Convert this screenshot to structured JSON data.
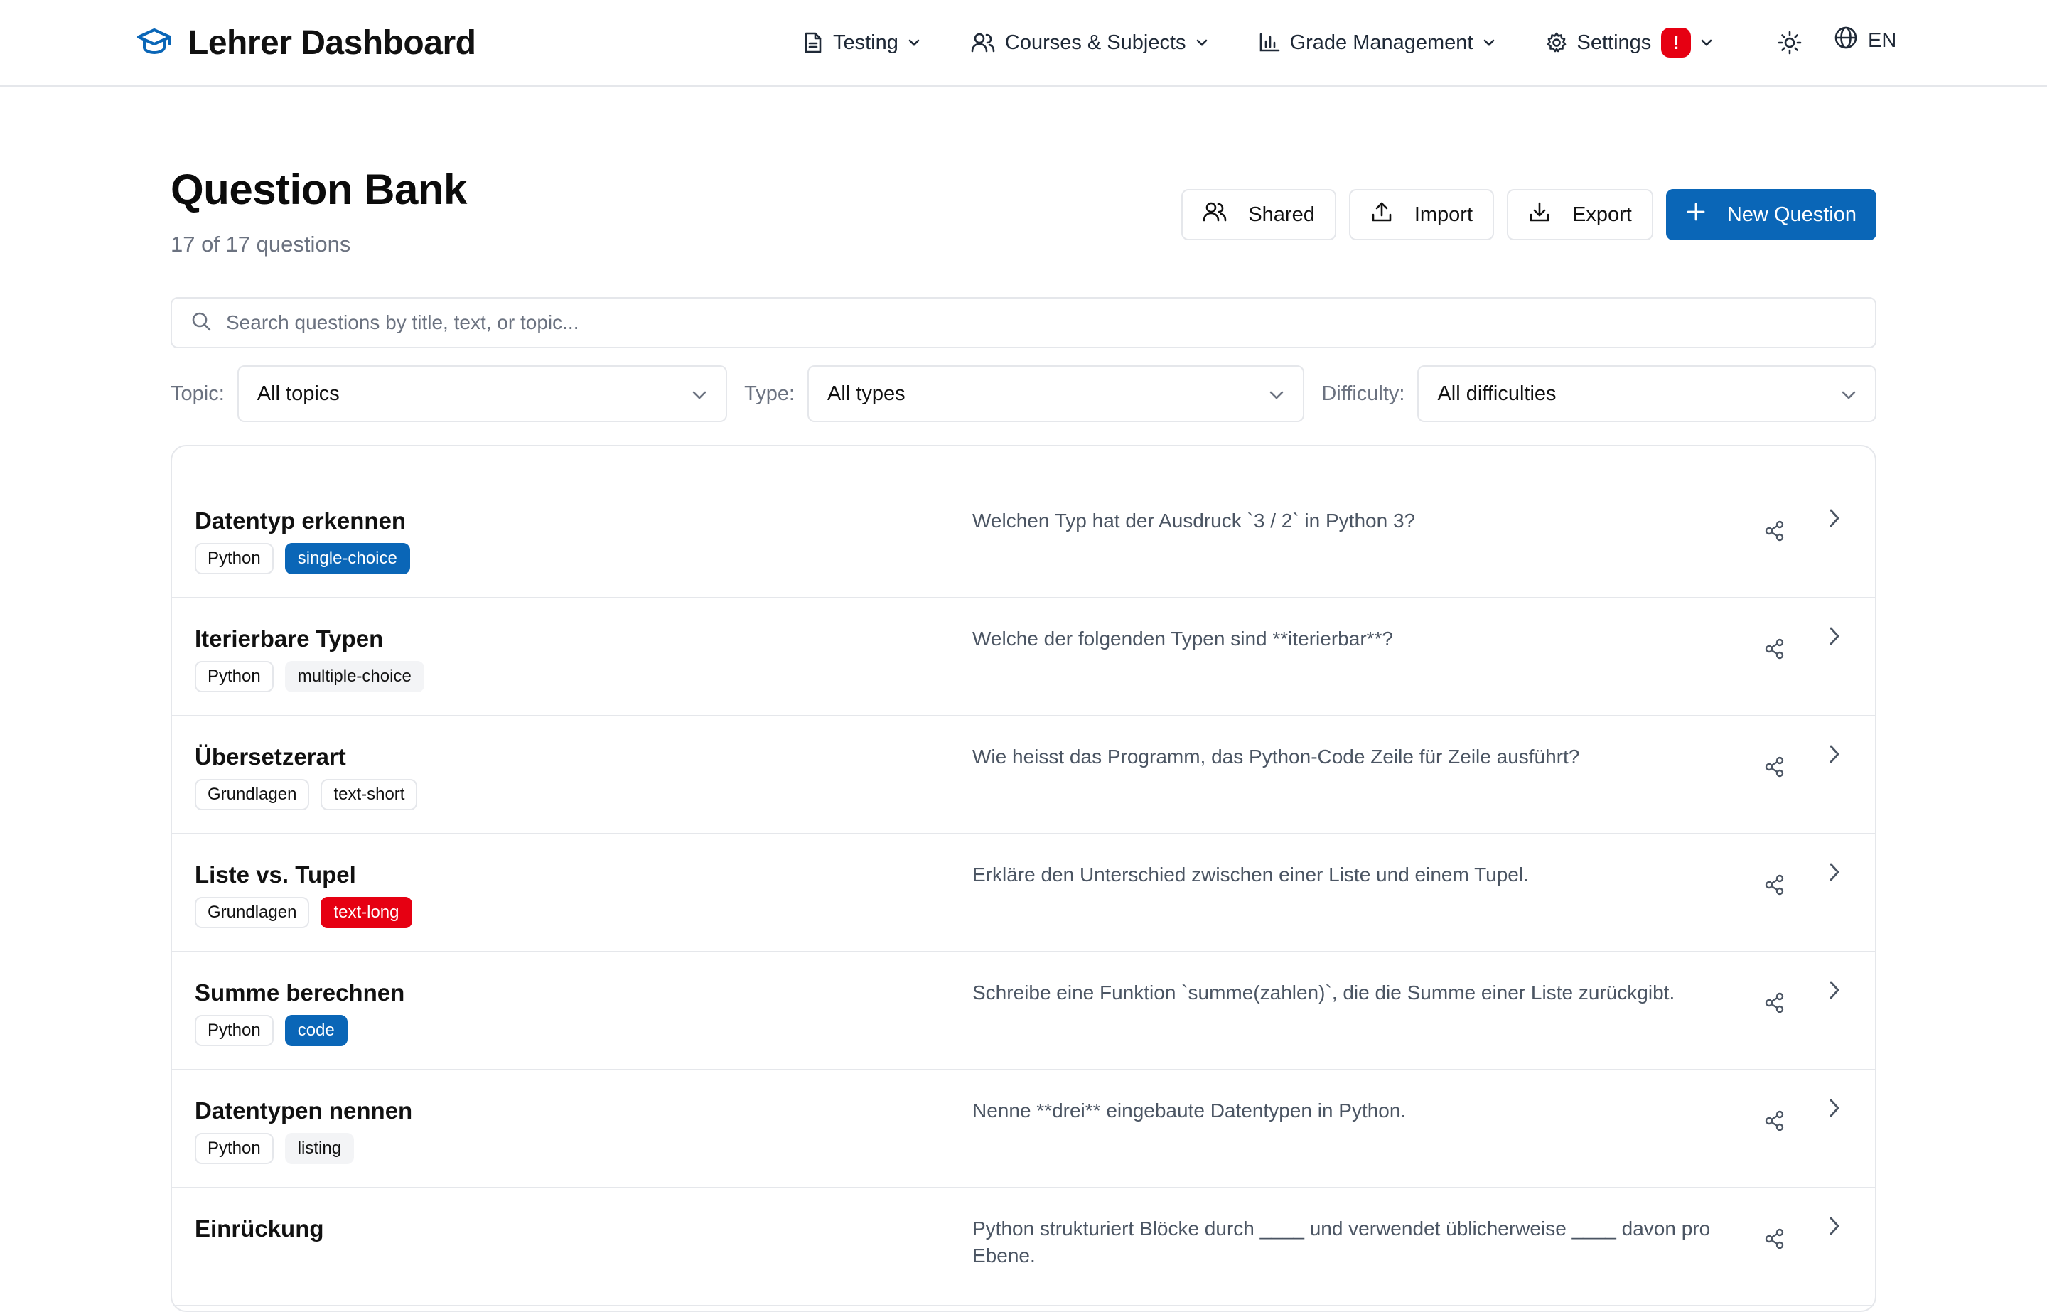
{
  "header": {
    "brand": "Lehrer Dashboard",
    "nav": [
      {
        "label": "Testing"
      },
      {
        "label": "Courses & Subjects"
      },
      {
        "label": "Grade Management"
      },
      {
        "label": "Settings",
        "badge": "!"
      }
    ],
    "language": "EN"
  },
  "page": {
    "title": "Question Bank",
    "count": "17 of 17 questions"
  },
  "actions": {
    "shared": "Shared",
    "import": "Import",
    "export": "Export",
    "new_question": "New Question"
  },
  "search": {
    "placeholder": "Search questions by title, text, or topic...",
    "value": ""
  },
  "filters": {
    "topic_label": "Topic:",
    "topic_value": "All topics",
    "type_label": "Type:",
    "type_value": "All types",
    "difficulty_label": "Difficulty:",
    "difficulty_value": "All difficulties"
  },
  "questions": [
    {
      "title": "Datentyp erkennen",
      "topic": "Python",
      "type": "single-choice",
      "text": "Welchen Typ hat der Ausdruck `3 / 2` in Python 3?"
    },
    {
      "title": "Iterierbare Typen",
      "topic": "Python",
      "type": "multiple-choice",
      "text": "Welche der folgenden Typen sind **iterierbar**?"
    },
    {
      "title": "Übersetzerart",
      "topic": "Grundlagen",
      "type": "text-short",
      "text": "Wie heisst das Programm, das Python-Code Zeile für Zeile ausführt?"
    },
    {
      "title": "Liste vs. Tupel",
      "topic": "Grundlagen",
      "type": "text-long",
      "text": "Erkläre den Unterschied zwischen einer Liste und einem Tupel."
    },
    {
      "title": "Summe berechnen",
      "topic": "Python",
      "type": "code",
      "text": "Schreibe eine Funktion `summe(zahlen)`, die die Summe einer Liste zurückgibt."
    },
    {
      "title": "Datentypen nennen",
      "topic": "Python",
      "type": "listing",
      "text": "Nenne **drei** eingebaute Datentypen in Python."
    },
    {
      "title": "Einrückung",
      "topic": "",
      "type": "",
      "text": "Python strukturiert Blöcke durch ____ und verwendet üblicherweise ____ davon pro Ebene."
    }
  ],
  "colors": {
    "accent": "#0a66b7",
    "alert": "#e60012",
    "border": "#e5e7eb",
    "muted_text": "#6b7280"
  },
  "icons": {
    "brand": "graduation-cap-icon",
    "testing": "document-icon",
    "courses": "users-icon",
    "grades": "bar-chart-icon",
    "settings": "gear-icon",
    "theme": "sun-icon",
    "language": "globe-icon",
    "share": "share-icon",
    "open": "chevron-right-icon"
  }
}
